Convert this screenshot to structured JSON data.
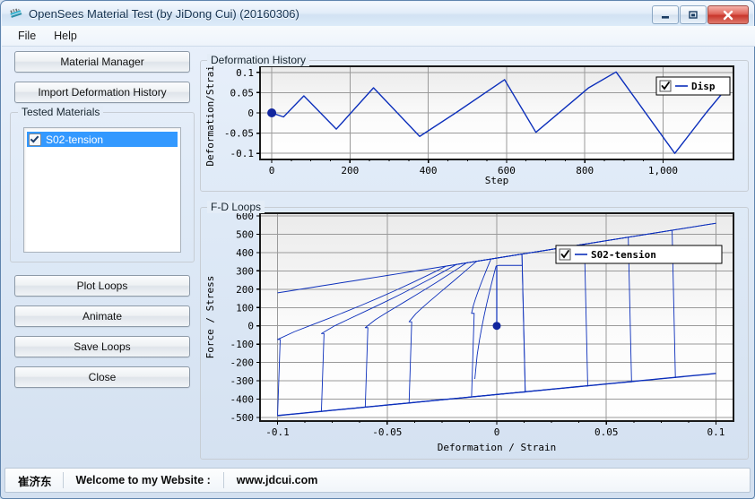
{
  "window": {
    "title": "OpenSees Material Test (by JiDong Cui) (20160306)",
    "icon": "app-icon",
    "controls": [
      {
        "name": "minimize",
        "glyph": "minimize-icon"
      },
      {
        "name": "restore",
        "glyph": "restore-icon"
      },
      {
        "name": "close",
        "glyph": "close-icon"
      }
    ]
  },
  "menu": {
    "items": [
      {
        "label": "File"
      },
      {
        "label": "Help"
      }
    ]
  },
  "sidebar": {
    "top_buttons": [
      {
        "label": "Material Manager"
      },
      {
        "label": "Import Deformation History"
      }
    ],
    "group": {
      "title": "Tested Materials",
      "items": [
        {
          "label": "S02-tension",
          "checked": true,
          "selected": true
        }
      ]
    },
    "bottom_buttons": [
      {
        "label": "Plot Loops"
      },
      {
        "label": "Animate"
      },
      {
        "label": "Save Loops"
      },
      {
        "label": "Close"
      }
    ]
  },
  "status_bar": {
    "author": "崔济东",
    "welcome": "Welcome to my Website :",
    "website": "www.jdcui.com"
  },
  "colors": {
    "series": "#0c2fbb",
    "marker": "#12269e",
    "grid": "#9a9a9a",
    "axis": "#000000",
    "selection": "#3399ff"
  },
  "chart_data": [
    {
      "id": "deformation-history",
      "type": "line",
      "title": "Deformation History",
      "xlabel": "Step",
      "ylabel": "Deformation/Strain",
      "xlim": [
        -30,
        1180
      ],
      "ylim": [
        -0.115,
        0.115
      ],
      "xticks": [
        0,
        200,
        400,
        600,
        800,
        1000
      ],
      "xticklabels": [
        "0",
        "200",
        "400",
        "600",
        "800",
        "1,000"
      ],
      "yticks": [
        -0.1,
        -0.05,
        0,
        0.05,
        0.1
      ],
      "yticklabels": [
        "-0.1",
        "-0.05",
        "0",
        "0.05",
        "0.1"
      ],
      "grid": true,
      "legend": {
        "position": "top-right",
        "entries": [
          {
            "label": "Disp",
            "checked": true
          }
        ]
      },
      "marker": {
        "x": 0,
        "y": 0
      },
      "series": [
        {
          "name": "Disp",
          "x": [
            0,
            30,
            82,
            165,
            260,
            378,
            470,
            595,
            675,
            810,
            880,
            1030,
            1110,
            1170
          ],
          "y": [
            0,
            -0.01,
            0.042,
            -0.04,
            0.062,
            -0.058,
            0.0,
            0.082,
            -0.048,
            0.062,
            0.101,
            -0.1,
            0.0,
            0.07
          ]
        }
      ]
    },
    {
      "id": "fd-loops",
      "type": "line",
      "title": "F-D Loops",
      "xlabel": "Deformation / Strain",
      "ylabel": "Force / Stress",
      "xlim": [
        -0.108,
        0.108
      ],
      "ylim": [
        -520,
        615
      ],
      "xticks": [
        -0.1,
        -0.05,
        0,
        0.05,
        0.1
      ],
      "xticklabels": [
        "-0.1",
        "-0.05",
        "0",
        "0.05",
        "0.1"
      ],
      "yticks": [
        -500,
        -400,
        -300,
        -200,
        -100,
        0,
        100,
        200,
        300,
        400,
        500,
        600
      ],
      "yticklabels": [
        "-500",
        "-400",
        "-300",
        "-200",
        "-100",
        "0",
        "100",
        "200",
        "300",
        "400",
        "500",
        "600"
      ],
      "grid": true,
      "legend": {
        "position": "upper-right-inside",
        "entries": [
          {
            "label": "S02-tension",
            "checked": true
          }
        ]
      },
      "marker": {
        "x": 0,
        "y": 0
      },
      "cycles": [
        {
          "amp": 0.0115,
          "peak_pos": 330,
          "peak_neg": -300
        },
        {
          "amp": 0.04,
          "peak_pos": 350,
          "peak_neg": -315
        },
        {
          "amp": 0.06,
          "peak_pos": 375,
          "peak_neg": -330
        },
        {
          "amp": 0.08,
          "peak_pos": 400,
          "peak_neg": -355
        },
        {
          "amp": 0.1,
          "peak_pos": 430,
          "peak_neg": -380
        },
        {
          "amp": 0.01,
          "peak_pos": 300,
          "peak_neg": -290
        }
      ],
      "note": "Pinched hysteresis loops of growing amplitude, envelope from about -490 at x=-0.1 to about 560 at x=0.1"
    }
  ]
}
